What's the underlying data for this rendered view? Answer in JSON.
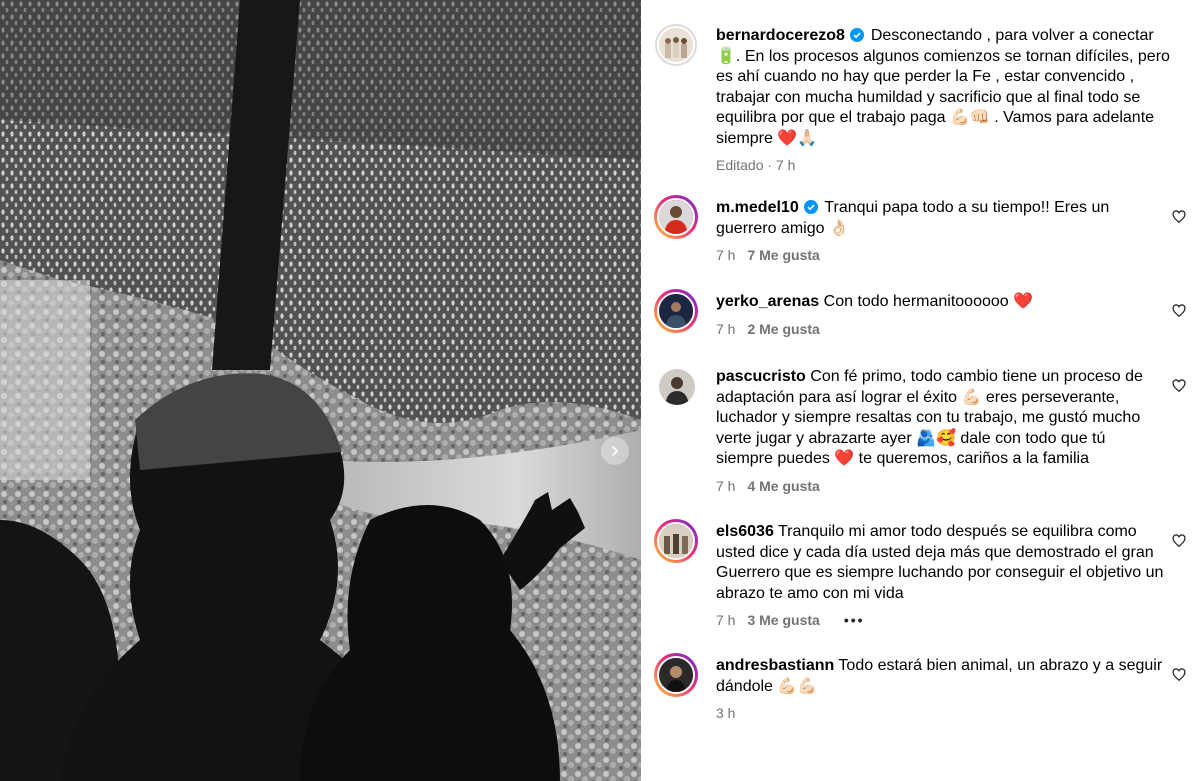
{
  "caption": {
    "username": "bernardocerezo8",
    "text": "Desconectando , para volver a conectar 🔋. En los procesos algunos comienzos se tornan difíciles, pero es ahí cuando no hay que perder la Fe , estar convencido , trabajar con mucha humildad y sacrificio que al final todo se equilibra por que el trabajo paga 💪🏻👊🏻 . Vamos para adelante siempre ❤️🙏🏻",
    "meta": "Editado · 7 h"
  },
  "comments": [
    {
      "username": "m.medel10",
      "verified": true,
      "text": "Tranqui papa todo a su tiempo!! Eres un guerrero amigo 👌🏻",
      "time": "7 h",
      "likes": "7 Me gusta",
      "more": ""
    },
    {
      "username": "yerko_arenas",
      "verified": false,
      "text": "Con todo hermanitoooooo ❤️",
      "time": "7 h",
      "likes": "2 Me gusta",
      "more": ""
    },
    {
      "username": "pascucristo",
      "verified": false,
      "text": "Con fé primo, todo cambio tiene un proceso de adaptación para así lograr el éxito 💪🏻 eres perseverante, luchador y siempre resaltas con tu trabajo, me gustó mucho verte jugar y abrazarte ayer 🫂🥰 dale con todo que tú siempre puedes ❤️ te queremos, cariños a la familia",
      "time": "7 h",
      "likes": "4 Me gusta",
      "more": ""
    },
    {
      "username": "els6036",
      "verified": false,
      "text": "Tranquilo mi amor todo después se equilibra como usted dice y cada día usted deja más que demostrado el gran Guerrero que es siempre luchando por conseguir el objetivo un abrazo te amo con mi vida",
      "time": "7 h",
      "likes": "3 Me gusta",
      "more": "•••"
    },
    {
      "username": "andresbastiann",
      "verified": false,
      "text": "Todo estará bien animal, un abrazo y a seguir dándole 💪🏻💪🏻",
      "time": "3 h",
      "likes": "",
      "more": ""
    }
  ]
}
